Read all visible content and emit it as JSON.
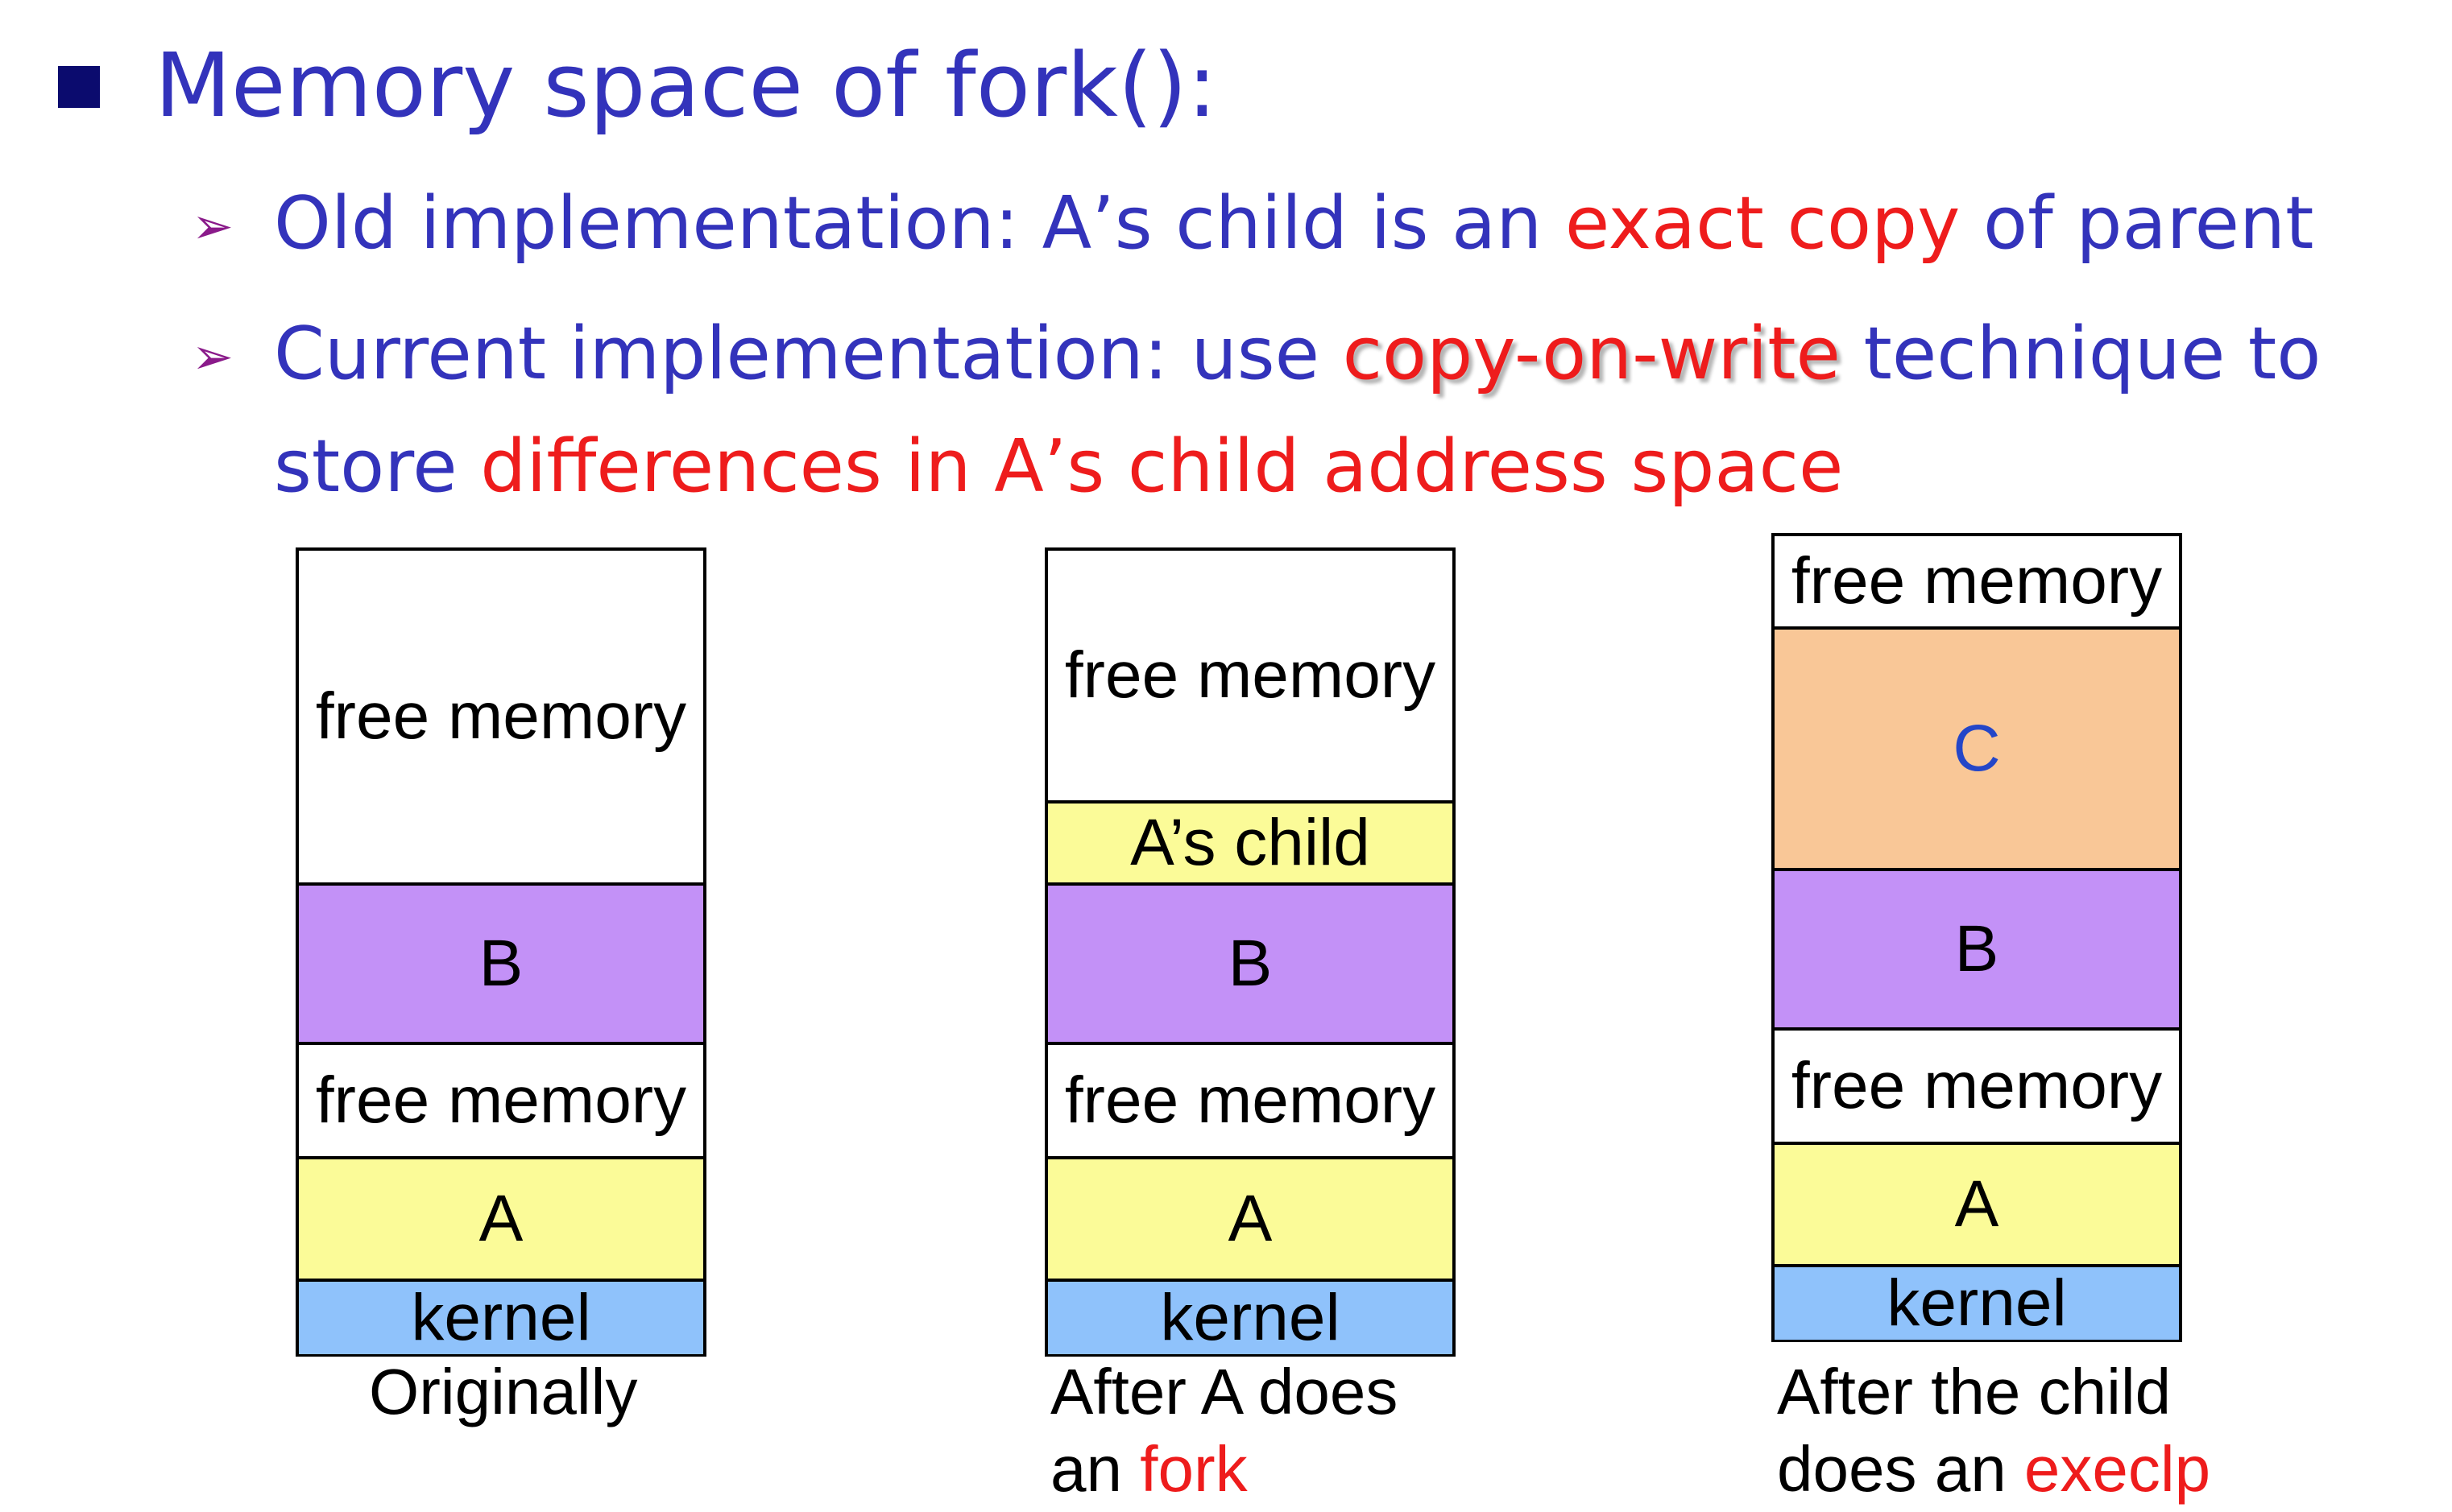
{
  "title": "Memory space of fork():",
  "bullets": [
    {
      "parts": [
        "Old implementation: A’s child is an ",
        "exact copy",
        " of parent"
      ]
    },
    {
      "line1": [
        "Current implementation: use ",
        "copy-on-write",
        " technique to"
      ],
      "line2": [
        "store ",
        "differences in A’s child address space"
      ]
    }
  ],
  "diagrams": [
    {
      "segments": [
        "free memory",
        "B",
        "free memory",
        "A",
        "kernel"
      ],
      "caption": [
        "Originally"
      ]
    },
    {
      "segments": [
        "free memory",
        "A’s child",
        "B",
        "free memory",
        "A",
        "kernel"
      ],
      "caption": [
        "After A does",
        "an ",
        "fork"
      ]
    },
    {
      "segments": [
        "free memory",
        "C",
        "B",
        "free memory",
        "A",
        "kernel"
      ],
      "caption": [
        "After the child",
        "does an ",
        "execlp"
      ]
    }
  ],
  "colors": {
    "title": "#3333bb",
    "emphasis": "#ee1c1c",
    "process_b": "#c391f7",
    "process_a": "#fbfb98",
    "kernel": "#8fc2fb",
    "process_c": "#f9c797"
  }
}
